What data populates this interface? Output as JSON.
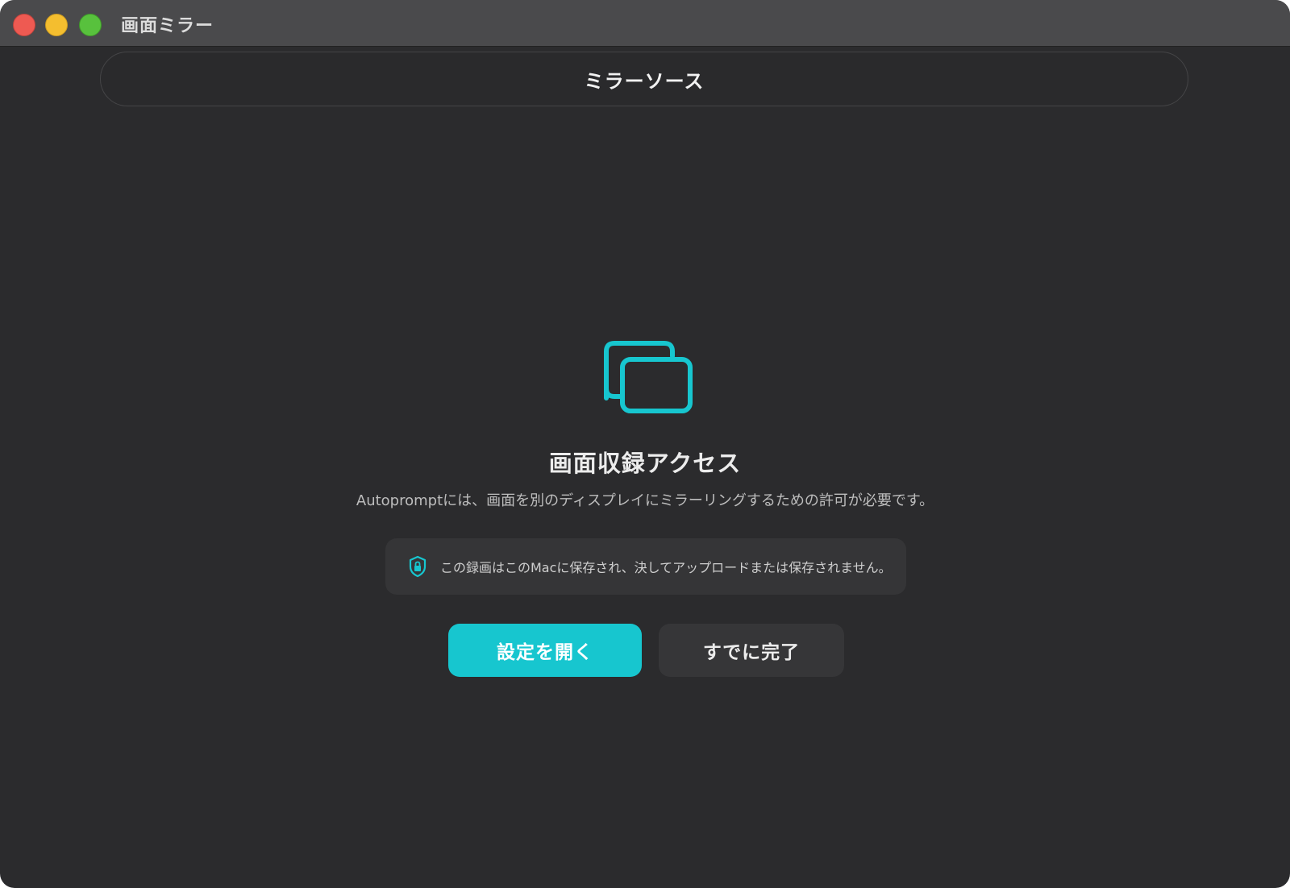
{
  "window": {
    "title": "画面ミラー"
  },
  "tab": {
    "label": "ミラーソース"
  },
  "main": {
    "icon": "screens-stack-icon",
    "heading": "画面収録アクセス",
    "description": "Autopromptには、画面を別のディスプレイにミラーリングするための許可が必要です。",
    "privacy_note": "この録画はこのMacに保存され、決してアップロードまたは保存されません。",
    "privacy_icon": "shield-lock-icon"
  },
  "buttons": {
    "open_settings": "設定を開く",
    "already_done": "すでに完了"
  },
  "colors": {
    "accent": "#17c6cf",
    "background": "#2b2b2d",
    "titlebar": "#4a4a4c"
  }
}
